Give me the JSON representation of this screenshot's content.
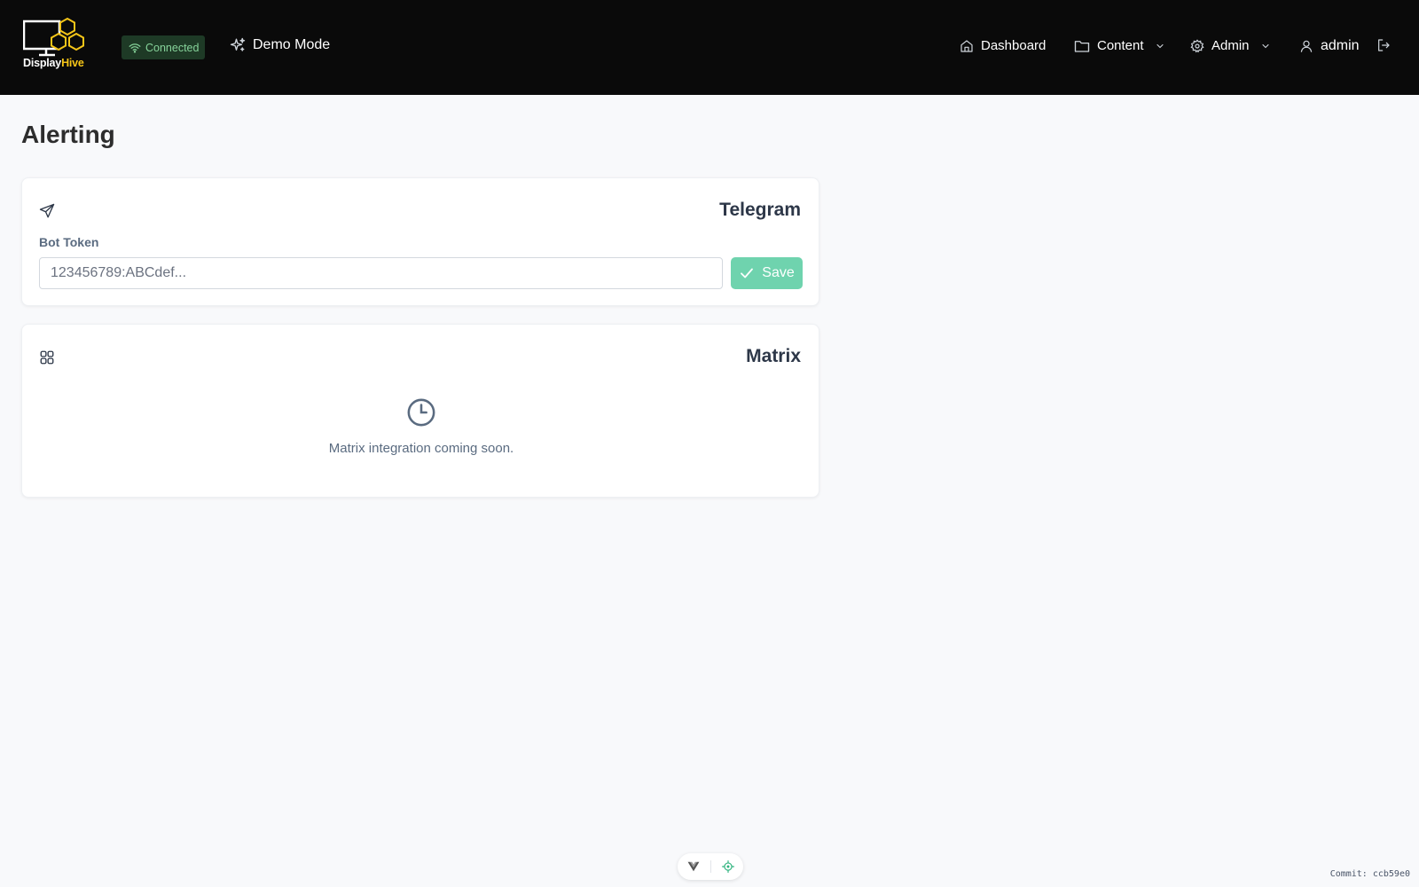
{
  "brand": {
    "name_part1": "Display",
    "name_part2": "Hive",
    "accent_color": "#f5c518"
  },
  "header": {
    "connection_status": "Connected",
    "connection_icon": "wifi-icon",
    "demo_mode_label": "Demo Mode",
    "demo_mode_icon": "sparkles-icon"
  },
  "nav": {
    "dashboard": {
      "label": "Dashboard",
      "icon": "home-icon"
    },
    "content": {
      "label": "Content",
      "icon": "folder-icon"
    },
    "admin": {
      "label": "Admin",
      "icon": "gear-icon"
    },
    "user": {
      "label": "admin",
      "icon": "user-icon"
    },
    "logout_icon": "logout-icon"
  },
  "page": {
    "title": "Alerting"
  },
  "telegram": {
    "title": "Telegram",
    "icon": "send-icon",
    "bot_token_label": "Bot Token",
    "bot_token_value": "",
    "bot_token_placeholder": "123456789:ABCdef...",
    "save_label": "Save",
    "save_color": "#6fd3ae"
  },
  "matrix": {
    "title": "Matrix",
    "icon": "grid-icon",
    "status_icon": "clock-icon",
    "message": "Matrix integration coming soon."
  },
  "footer": {
    "commit_text": "Commit: ccb59e0"
  }
}
